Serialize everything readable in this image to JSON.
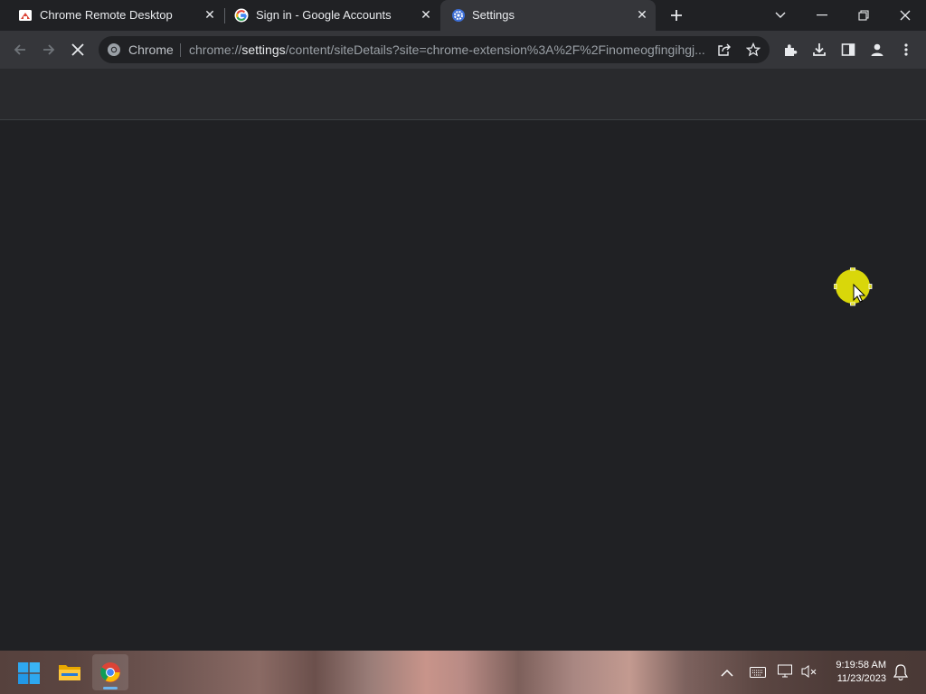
{
  "tabs": [
    {
      "title": "Chrome Remote Desktop",
      "icon": "chrome-remote-desktop-icon",
      "active": false
    },
    {
      "title": "Sign in - Google Accounts",
      "icon": "google-g-icon",
      "active": false
    },
    {
      "title": "Settings",
      "icon": "settings-gear-icon",
      "active": true
    }
  ],
  "omnibox": {
    "site_chip": "Chrome",
    "url_prefix": "chrome://",
    "url_host": "settings",
    "url_rest": "/content/siteDetails?site=chrome-extension%3A%2F%2Finomeogfingihgj..."
  },
  "taskbar": {
    "time": "9:19:58 AM",
    "date": "11/23/2023"
  },
  "colors": {
    "page_bg": "#202124",
    "toolbar_bg": "#35363a",
    "header_bg": "#292a2d",
    "cursor_highlight": "#d9d70a"
  }
}
